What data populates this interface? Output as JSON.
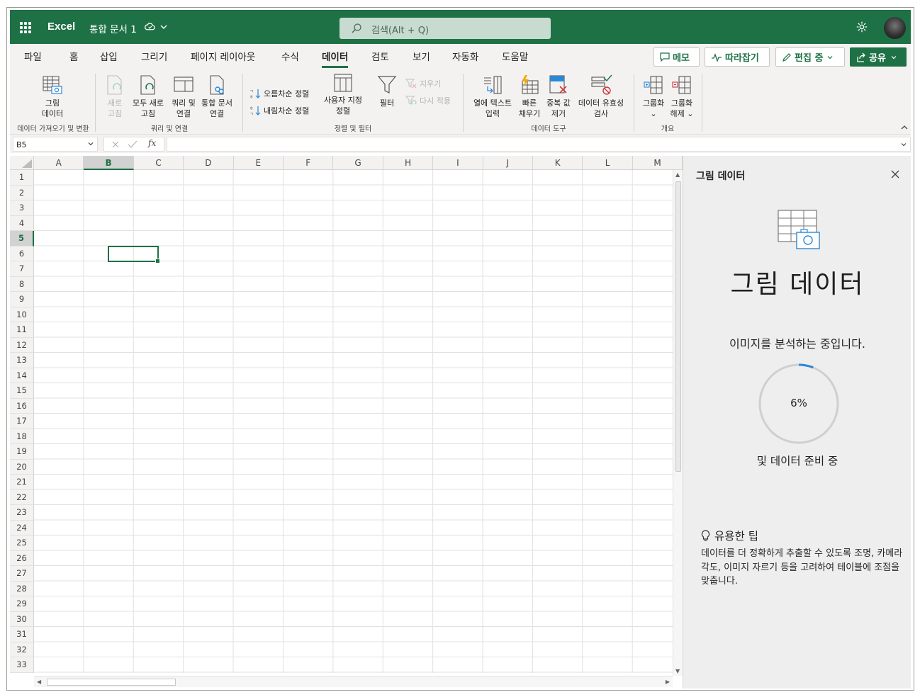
{
  "app": {
    "name": "Excel",
    "document": "통합 문서 1",
    "search_placeholder": "검색(Alt + Q)"
  },
  "tabs": [
    "파일",
    "홈",
    "삽입",
    "그리기",
    "페이지 레이아웃",
    "수식",
    "데이터",
    "검토",
    "보기",
    "자동화",
    "도움말"
  ],
  "active_tab": "데이터",
  "actions": {
    "memo": "메모",
    "track": "따라잡기",
    "editing": "편집 중",
    "share": "공유"
  },
  "ribbon": {
    "picture_data": [
      "그림",
      "데이터"
    ],
    "group_get": "데이터 가져오기 및 변환",
    "refresh": [
      "새로",
      "고침"
    ],
    "refresh_all": [
      "모두 새로",
      "고침"
    ],
    "queries": [
      "쿼리 및",
      "연결"
    ],
    "workbook_links": [
      "통합 문서",
      "연결"
    ],
    "group_queries": "쿼리 및 연결",
    "sort_asc": "오름차순 정렬",
    "sort_desc": "내림차순 정렬",
    "custom_sort": [
      "사용자 지정",
      "정렬"
    ],
    "filter": "필터",
    "clear": "지우기",
    "reapply": "다시 적용",
    "group_sort": "정렬 및 필터",
    "text_to_columns": [
      "열에 텍스트",
      "입력"
    ],
    "flash_fill": [
      "빠른",
      "채우기"
    ],
    "remove_dup": [
      "중복 값",
      "제거"
    ],
    "validation": [
      "데이터 유효성",
      "검사"
    ],
    "group_tools": "데이터 도구",
    "group": [
      "그룹화",
      "⌄"
    ],
    "ungroup": [
      "그룹화",
      "해제 ⌄"
    ],
    "group_outline": "개요"
  },
  "name_box": "B5",
  "fx": "fx",
  "columns": [
    "A",
    "B",
    "C",
    "D",
    "E",
    "F",
    "G",
    "H",
    "I",
    "J",
    "K",
    "L",
    "M"
  ],
  "selected_column": "B",
  "rows": [
    "1",
    "2",
    "3",
    "4",
    "5",
    "6",
    "7",
    "8",
    "9",
    "10",
    "11",
    "12",
    "13",
    "14",
    "15",
    "16",
    "17",
    "18",
    "19",
    "20",
    "21",
    "22",
    "23",
    "24",
    "25",
    "26",
    "27",
    "28",
    "29",
    "30",
    "31",
    "32",
    "33"
  ],
  "selected_row": "5",
  "pane": {
    "title": "그림 데이터",
    "heading": "그림 데이터",
    "status": "이미지를 분석하는 중입니다.",
    "progress_label": "6%",
    "progress": 0.06,
    "substatus": "및 데이터 준비 중",
    "tip_title": "유용한 팁",
    "tip_text": "데이터를 더 정확하게 추출할 수 있도록 조명, 카메라 각도, 이미지 자르기 등을 고려하여 테이블에 조점을 맞춥니다."
  },
  "colors": {
    "brand": "#1e7145",
    "ribbon_bg": "#f3f2f1",
    "pane_bg": "#eeeeee",
    "progress": "#2b88d8"
  }
}
